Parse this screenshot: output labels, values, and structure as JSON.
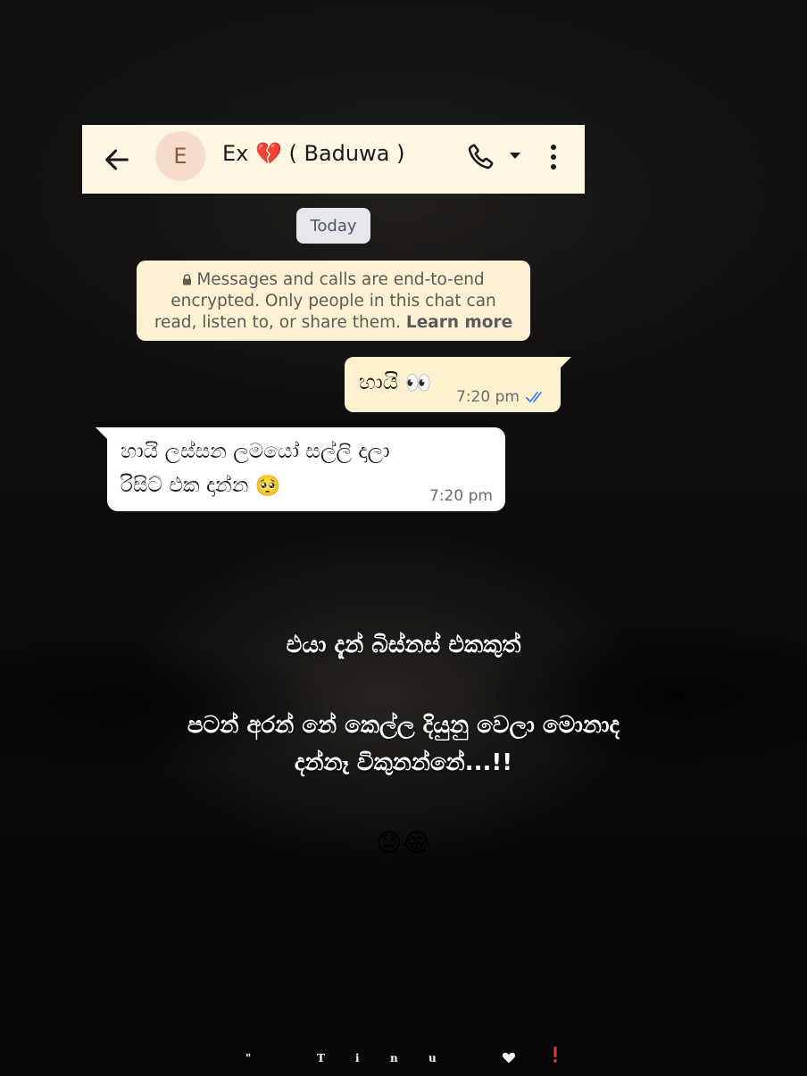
{
  "header": {
    "avatar_letter": "E",
    "contact_name": "Ex 💔 ( Baduwa )"
  },
  "date_chip": "Today",
  "encryption_notice": {
    "text_line1": "Messages and calls are end-to-end",
    "text_line2": "encrypted. Only people in this chat can",
    "text_line3": "read, listen to, or share them.",
    "learn_more": "Learn more"
  },
  "messages": [
    {
      "direction": "outgoing",
      "text": "හායි",
      "emoji": "👀",
      "time": "7:20 pm",
      "status": "read"
    },
    {
      "direction": "incoming",
      "text_line1": "හායි ලස්සන ලමයෝ සල්ලි දාලා",
      "text_line2": "රිසිට් එක දාන්න",
      "emoji": "🥺",
      "time": "7:20 pm"
    }
  ],
  "caption": {
    "line1": "එයා දැන් බිස්නස් එකකුත්",
    "line2": "පටන් අරන් නේ කෙල්ල දියුනු වෙලා  මොනාද",
    "line3": "දන්නෑ විකුනන්නේ...!!",
    "emojis": "😓😂"
  },
  "footer": {
    "glyphs": [
      "\"",
      "T",
      "i",
      "n",
      "u"
    ]
  },
  "colors": {
    "header_bg": "#fdf6e3",
    "outgoing_bubble": "#fdf1d0",
    "incoming_bubble": "#ffffff",
    "read_ticks": "#3b82f6"
  },
  "icons": [
    "back-arrow-icon",
    "phone-icon",
    "chevron-down-icon",
    "more-vert-icon",
    "lock-icon",
    "double-check-icon",
    "heart-icon",
    "exclamation-icon"
  ]
}
